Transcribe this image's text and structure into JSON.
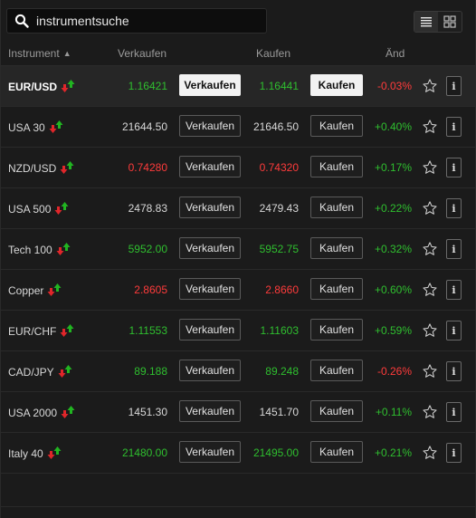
{
  "search": {
    "value": "instrumentsuche",
    "placeholder": "instrumentsuche"
  },
  "view_toggle": {
    "list_icon": "list-view-icon",
    "grid_icon": "grid-view-icon",
    "active": "list"
  },
  "header": {
    "instrument": "Instrument",
    "sell": "Verkaufen",
    "buy": "Kaufen",
    "change": "Änd"
  },
  "colors": {
    "up": "#2fbf2f",
    "down": "#ff3b3b",
    "neutral": "#d8d8d8"
  },
  "rows": [
    {
      "name": "EUR/USD",
      "sell_price": "1.16421",
      "sell_label": "Verkaufen",
      "buy_price": "1.16441",
      "buy_label": "Kaufen",
      "change": "-0.03%",
      "price_color": "pos",
      "change_color": "neg",
      "selected": true
    },
    {
      "name": "USA 30",
      "sell_price": "21644.50",
      "sell_label": "Verkaufen",
      "buy_price": "21646.50",
      "buy_label": "Kaufen",
      "change": "+0.40%",
      "price_color": "neu",
      "change_color": "pos",
      "selected": false
    },
    {
      "name": "NZD/USD",
      "sell_price": "0.74280",
      "sell_label": "Verkaufen",
      "buy_price": "0.74320",
      "buy_label": "Kaufen",
      "change": "+0.17%",
      "price_color": "neg",
      "change_color": "pos",
      "selected": false
    },
    {
      "name": "USA 500",
      "sell_price": "2478.83",
      "sell_label": "Verkaufen",
      "buy_price": "2479.43",
      "buy_label": "Kaufen",
      "change": "+0.22%",
      "price_color": "neu",
      "change_color": "pos",
      "selected": false
    },
    {
      "name": "Tech 100",
      "sell_price": "5952.00",
      "sell_label": "Verkaufen",
      "buy_price": "5952.75",
      "buy_label": "Kaufen",
      "change": "+0.32%",
      "price_color": "pos",
      "change_color": "pos",
      "selected": false
    },
    {
      "name": "Copper",
      "sell_price": "2.8605",
      "sell_label": "Verkaufen",
      "buy_price": "2.8660",
      "buy_label": "Kaufen",
      "change": "+0.60%",
      "price_color": "neg",
      "change_color": "pos",
      "selected": false
    },
    {
      "name": "EUR/CHF",
      "sell_price": "1.11553",
      "sell_label": "Verkaufen",
      "buy_price": "1.11603",
      "buy_label": "Kaufen",
      "change": "+0.59%",
      "price_color": "pos",
      "change_color": "pos",
      "selected": false
    },
    {
      "name": "CAD/JPY",
      "sell_price": "89.188",
      "sell_label": "Verkaufen",
      "buy_price": "89.248",
      "buy_label": "Kaufen",
      "change": "-0.26%",
      "price_color": "pos",
      "change_color": "neg",
      "selected": false
    },
    {
      "name": "USA 2000",
      "sell_price": "1451.30",
      "sell_label": "Verkaufen",
      "buy_price": "1451.70",
      "buy_label": "Kaufen",
      "change": "+0.11%",
      "price_color": "neu",
      "change_color": "pos",
      "selected": false
    },
    {
      "name": "Italy 40",
      "sell_price": "21480.00",
      "sell_label": "Verkaufen",
      "buy_price": "21495.00",
      "buy_label": "Kaufen",
      "change": "+0.21%",
      "price_color": "pos",
      "change_color": "pos",
      "selected": false
    }
  ],
  "row_icons": {
    "trend": "up-down-arrows-icon",
    "favorite": "star-icon",
    "info": "info-icon",
    "info_glyph": "i"
  }
}
